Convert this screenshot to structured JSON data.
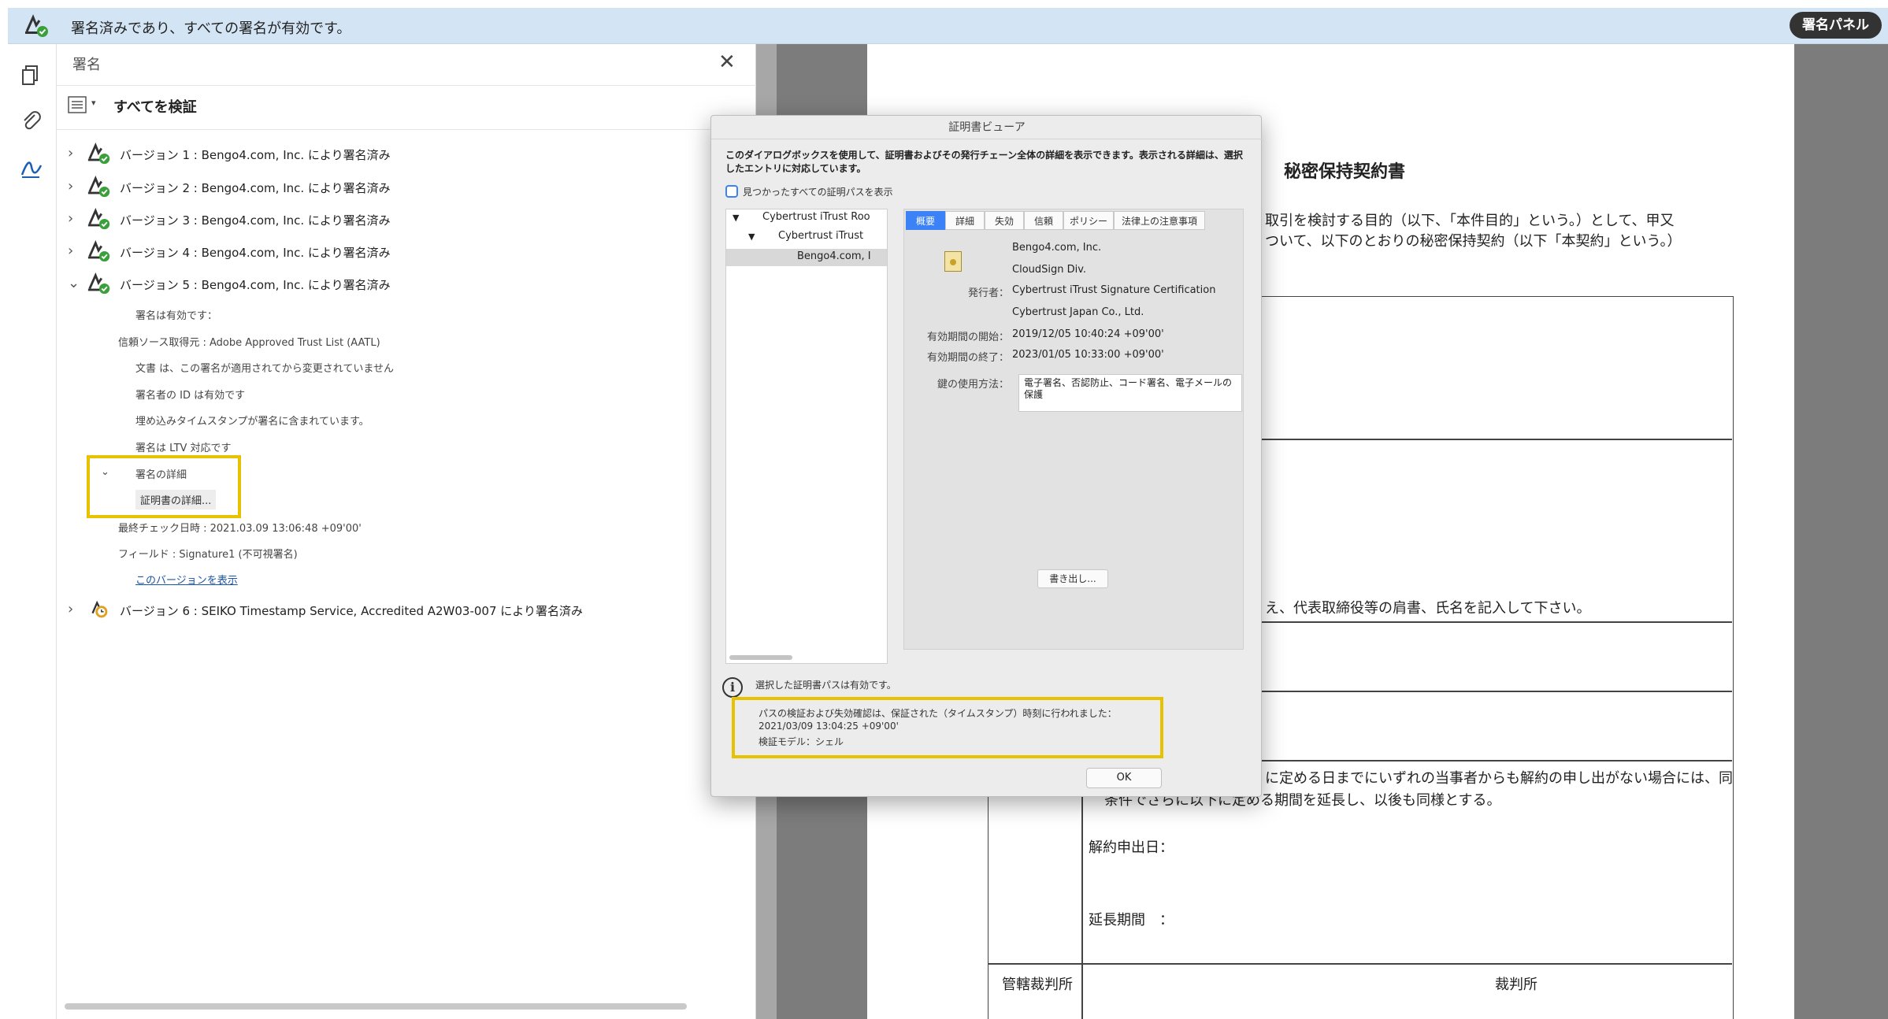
{
  "topbar": {
    "message": "署名済みであり、すべての署名が有効です。",
    "panel_button": "署名パネル"
  },
  "rail": {
    "icons": [
      "pages-icon",
      "attachment-icon",
      "signature-icon"
    ]
  },
  "sig_panel": {
    "title": "署名",
    "close": "✕",
    "verify_all": "すべてを検証",
    "versions": [
      {
        "label": "バージョン 1 : Bengo4.com, Inc. により署名済み",
        "expanded": false
      },
      {
        "label": "バージョン 2 : Bengo4.com, Inc. により署名済み",
        "expanded": false
      },
      {
        "label": "バージョン 3 : Bengo4.com, Inc. により署名済み",
        "expanded": false
      },
      {
        "label": "バージョン 4 : Bengo4.com, Inc. により署名済み",
        "expanded": false
      },
      {
        "label": "バージョン 5 : Bengo4.com, Inc. により署名済み",
        "expanded": true
      },
      {
        "label": "バージョン 6 : SEIKO Timestamp Service, Accredited A2W03-007 により署名済み",
        "expanded": false
      }
    ],
    "details": {
      "valid": "署名は有効です：",
      "trust_source": "信頼ソース取得元 : Adobe Approved Trust List (AATL)",
      "not_modified": "文書 は、この署名が適用されてから変更されていません",
      "signer_id_valid": "署名者の ID は有効です",
      "timestamp_included": "埋め込みタイムスタンプが署名に含まれています。",
      "ltv": "署名は LTV 対応です",
      "sig_details": "署名の詳細",
      "cert_details": "証明書の詳細...",
      "last_checked": "最終チェック日時 : 2021.03.09 13:06:48 +09'00'",
      "field": "フィールド : Signature1 (不可視署名)",
      "show_version": "このバージョンを表示"
    }
  },
  "document": {
    "title": "秘密保持契約書",
    "para1": "取引を検討する目的（以下、「本件目的」という。）として、甲又",
    "para2": "ついて、以下のとおりの秘密保持契約（以下「本契約」という。）",
    "note": "え、代表取締役等の肩書、氏名を記入して下さい。",
    "renewal1": "に定める日までにいずれの当事者からも解約の申し出がない場合には、同",
    "renewal2": "条件でさらに以下に定める期間を延長し、以後も同様とする。",
    "cancel_date": "解約申出日：",
    "extension": "延長期間　：",
    "court_label": "管轄裁判所",
    "court_value": "裁判所"
  },
  "dialog": {
    "title": "証明書ビューア",
    "description": "このダイアログボックスを使用して、証明書およびその発行チェーン全体の詳細を表示できます。表示される詳細は、選択したエントリに対応しています。",
    "show_all_paths": "見つかったすべての証明パスを表示",
    "tree": [
      "Cybertrust iTrust Roo",
      "Cybertrust iTrust",
      "Bengo4.com, I"
    ],
    "tabs": [
      "概要",
      "詳細",
      "失効",
      "信頼",
      "ポリシー",
      "法律上の注意事項"
    ],
    "active_tab": "概要",
    "subject": "Bengo4.com, Inc.",
    "subject_org": "CloudSign Div.",
    "issuer_label": "発行者：",
    "issuer": "Cybertrust iTrust Signature Certification",
    "issuer_org": "Cybertrust Japan Co., Ltd.",
    "valid_from_label": "有効期間の開始：",
    "valid_from": "2019/12/05 10:40:24 +09'00'",
    "valid_to_label": "有効期間の終了：",
    "valid_to": "2023/01/05 10:33:00 +09'00'",
    "usage_label": "鍵の使用方法：",
    "usage_value": "電子署名、否認防止、コード署名、電子メールの保護",
    "export_button": "書き出し...",
    "path_valid": "選択した証明書パスは有効です。",
    "timestamp_line1": "パスの検証および失効確認は、保証された（タイムスタンプ）時刻に行われました：",
    "timestamp_line2": "2021/03/09 13:04:25 +09'00'",
    "timestamp_line3": "検証モデル：シェル",
    "ok_button": "OK"
  },
  "colors": {
    "topbar": "#d3e5f5",
    "highlight": "#e6c200",
    "accent": "#3b82f6",
    "valid_check": "#3aa03a"
  }
}
